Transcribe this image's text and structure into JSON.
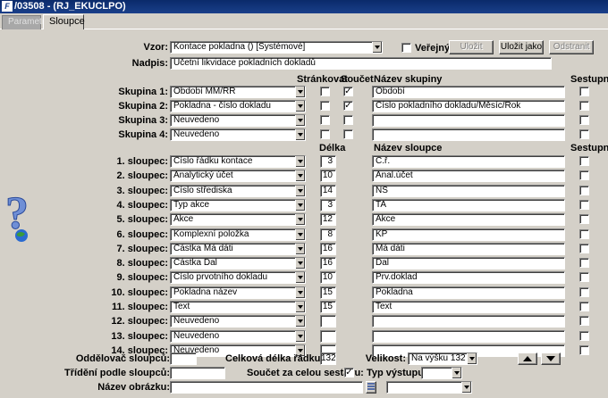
{
  "window": {
    "title": "/03508 - (RJ_EKUCLPO)",
    "icon": "app-icon"
  },
  "tabs": [
    {
      "label": "Parametry"
    },
    {
      "label": "Sloupce"
    }
  ],
  "top": {
    "vzor_label": "Vzor:",
    "vzor_value": "Kontace pokladna  ()  [Systémové]",
    "verejny_label": "Veřejný",
    "ulozit_label": "Uložit",
    "ulozit_jako_label": "Uložit jako",
    "odstranit_label": "Odstranit",
    "nadpis_label": "Nadpis:",
    "nadpis_value": "Účetní likvidace pokladních dokladů"
  },
  "group_headers": {
    "strankovat": "Stránkovat",
    "soucet": "Součet",
    "nazev_skupiny": "Název skupiny",
    "sestupne": "Sestupně"
  },
  "groups": [
    {
      "label": "Skupina 1:",
      "value": "Období MM/RR",
      "strankovat": false,
      "soucet": true,
      "name": "Období",
      "sestupne": false
    },
    {
      "label": "Skupina 2:",
      "value": "Pokladna - číslo dokladu",
      "strankovat": false,
      "soucet": true,
      "name": "Číslo pokladního dokladu/Měsíc/Rok",
      "sestupne": false
    },
    {
      "label": "Skupina 3:",
      "value": "Neuvedeno",
      "strankovat": false,
      "soucet": false,
      "name": "",
      "sestupne": false
    },
    {
      "label": "Skupina 4:",
      "value": "Neuvedeno",
      "strankovat": false,
      "soucet": false,
      "name": "",
      "sestupne": false
    }
  ],
  "column_headers": {
    "delka": "Délka",
    "nazev_sloupce": "Název sloupce",
    "sestupne": "Sestupně"
  },
  "columns": [
    {
      "label": "1. sloupec:",
      "value": "Číslo řádku kontace",
      "length": "3",
      "name": "Č.ř."
    },
    {
      "label": "2. sloupec:",
      "value": "Analytický účet",
      "length": "10",
      "name": "Anal.účet"
    },
    {
      "label": "3. sloupec:",
      "value": "Číslo střediska",
      "length": "14",
      "name": "NS"
    },
    {
      "label": "4. sloupec:",
      "value": "Typ akce",
      "length": "3",
      "name": "TA"
    },
    {
      "label": "5. sloupec:",
      "value": "Akce",
      "length": "12",
      "name": "Akce"
    },
    {
      "label": "6. sloupec:",
      "value": "Komplexní položka",
      "length": "8",
      "name": "KP"
    },
    {
      "label": "7. sloupec:",
      "value": "Částka Má dáti",
      "length": "16",
      "name": "Má dáti"
    },
    {
      "label": "8. sloupec:",
      "value": "Částka Dal",
      "length": "16",
      "name": "Dal"
    },
    {
      "label": "9. sloupec:",
      "value": "Číslo prvotního dokladu",
      "length": "10",
      "name": "Prv.doklad"
    },
    {
      "label": "10. sloupec:",
      "value": "Pokladna název",
      "length": "15",
      "name": "Pokladna"
    },
    {
      "label": "11. sloupec:",
      "value": "Text",
      "length": "15",
      "name": "Text"
    },
    {
      "label": "12. sloupec:",
      "value": "Neuvedeno",
      "length": "",
      "name": ""
    },
    {
      "label": "13. sloupec:",
      "value": "Neuvedeno",
      "length": "",
      "name": ""
    },
    {
      "label": "14. sloupec:",
      "value": "Neuvedeno",
      "length": "",
      "name": ""
    }
  ],
  "bottom": {
    "oddelovac_label": "Oddělovač sloupců:",
    "oddelovac_value": "",
    "celkova_label": "Celková délka řádku:",
    "celkova_value": "132",
    "velikost_label": "Velikost:",
    "velikost_value": "Na výšku 132 zn.",
    "trideni_label": "Třídění podle sloupců:",
    "trideni_value": "",
    "soucet_label": "Součet za celou sestavu:",
    "soucet_checked": true,
    "typ_label": "Typ výstupu:",
    "typ_value": "",
    "nazev_obrazku_label": "Název obrázku:",
    "nazev_obrazku_value": "",
    "obrazek_select_value": ""
  }
}
